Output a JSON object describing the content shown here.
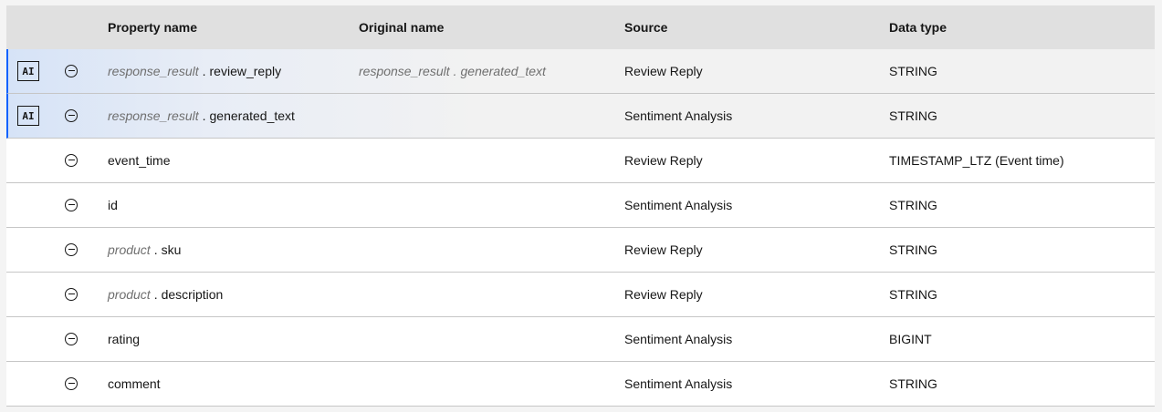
{
  "columns": {
    "property_name": "Property name",
    "original_name": "Original name",
    "source": "Source",
    "data_type": "Data type"
  },
  "ai_badge_label": "AI",
  "separator": ".",
  "rows": [
    {
      "ai": true,
      "prefix": "response_result",
      "name": "review_reply",
      "orig_prefix": "response_result",
      "orig_name": "generated_text",
      "source": "Review Reply",
      "type": "STRING"
    },
    {
      "ai": true,
      "prefix": "response_result",
      "name": "generated_text",
      "orig_prefix": "",
      "orig_name": "",
      "source": "Sentiment Analysis",
      "type": "STRING"
    },
    {
      "ai": false,
      "prefix": "",
      "name": "event_time",
      "orig_prefix": "",
      "orig_name": "",
      "source": "Review Reply",
      "type": "TIMESTAMP_LTZ (Event time)"
    },
    {
      "ai": false,
      "prefix": "",
      "name": "id",
      "orig_prefix": "",
      "orig_name": "",
      "source": "Sentiment Analysis",
      "type": "STRING"
    },
    {
      "ai": false,
      "prefix": "product",
      "name": "sku",
      "orig_prefix": "",
      "orig_name": "",
      "source": "Review Reply",
      "type": "STRING"
    },
    {
      "ai": false,
      "prefix": "product",
      "name": "description",
      "orig_prefix": "",
      "orig_name": "",
      "source": "Review Reply",
      "type": "STRING"
    },
    {
      "ai": false,
      "prefix": "",
      "name": "rating",
      "orig_prefix": "",
      "orig_name": "",
      "source": "Sentiment Analysis",
      "type": "BIGINT"
    },
    {
      "ai": false,
      "prefix": "",
      "name": "comment",
      "orig_prefix": "",
      "orig_name": "",
      "source": "Sentiment Analysis",
      "type": "STRING"
    }
  ],
  "colors": {
    "header_bg": "#e0e0e0",
    "ai_accent": "#0f62fe",
    "ai_row_bg": "#d6e3f7",
    "muted_text": "#6f6f6f",
    "border": "#c6c6c6"
  }
}
